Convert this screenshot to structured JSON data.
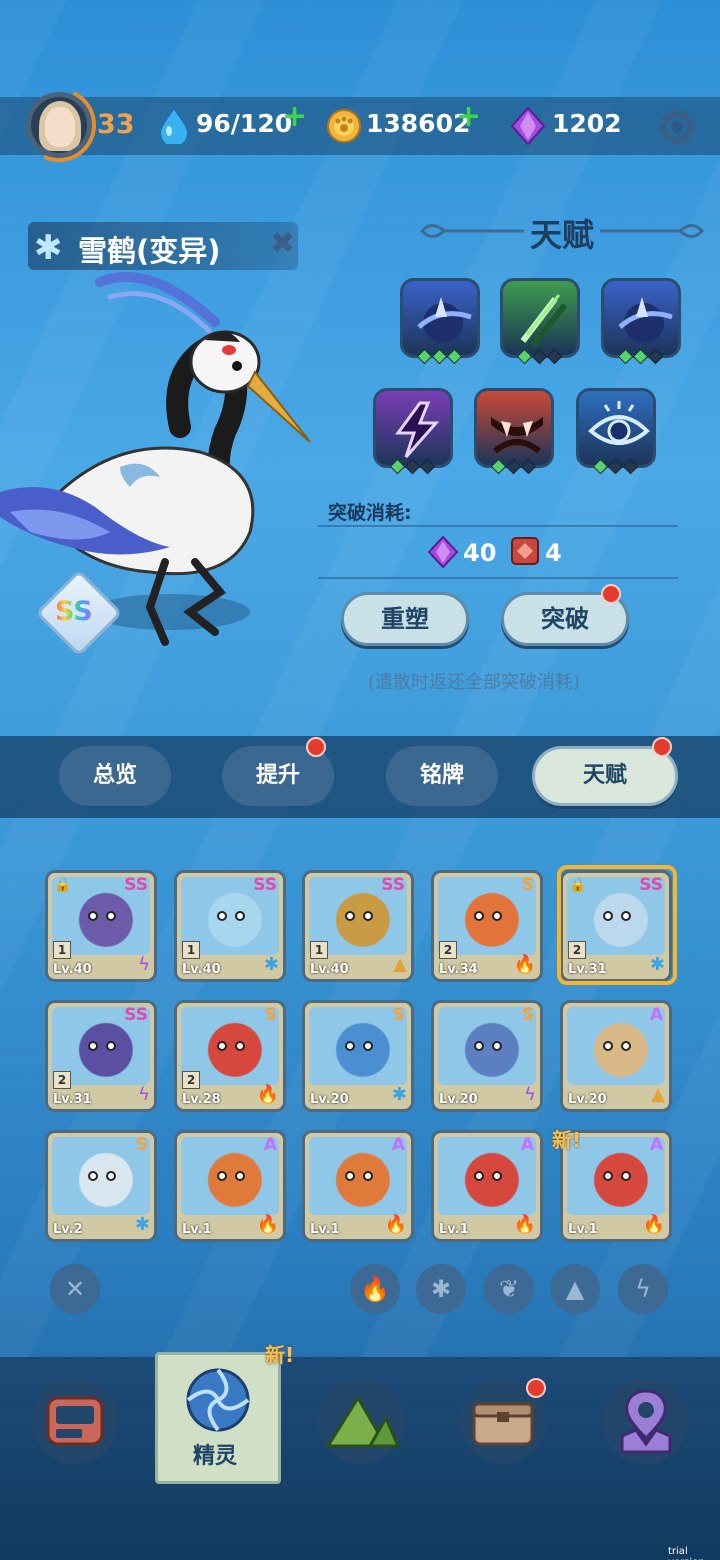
{
  "player": {
    "level": "33",
    "stamina": "96/120",
    "coins": "138602",
    "gems": "1202"
  },
  "pet": {
    "name": "雪鹤(变异)",
    "rank": "SS"
  },
  "talent": {
    "title": "天赋",
    "cost_label": "突破消耗:",
    "cost_gem": "40",
    "cost_item": "4",
    "reset_button": "重塑",
    "breakthrough_button": "突破",
    "hint": "(遣散时返还全部突破消耗)",
    "skills": [
      {
        "icon": "dark-dash-icon",
        "color": "#3b62c9",
        "filled": 3
      },
      {
        "icon": "claw-slash-icon",
        "color": "#3f9b4e",
        "filled": 1
      },
      {
        "icon": "dark-dash-icon",
        "color": "#3b62c9",
        "filled": 2
      },
      {
        "icon": "lightning-icon",
        "color": "#7a3fb6",
        "filled": 1
      },
      {
        "icon": "fang-icon",
        "color": "#c94a37",
        "filled": 1
      },
      {
        "icon": "eye-icon",
        "color": "#2f6fc0",
        "filled": 1
      }
    ]
  },
  "tabs": [
    "总览",
    "提升",
    "铭牌",
    "天赋"
  ],
  "active_tab": "天赋",
  "pets": [
    {
      "rank": "SS",
      "lv": "Lv.40",
      "star": "1",
      "elem": "lightning",
      "locked": true,
      "art": "#6b5ba8"
    },
    {
      "rank": "SS",
      "lv": "Lv.40",
      "star": "1",
      "elem": "ice",
      "locked": false,
      "art": "#a7d7ef"
    },
    {
      "rank": "SS",
      "lv": "Lv.40",
      "star": "1",
      "elem": "earth",
      "locked": false,
      "art": "#c99a44"
    },
    {
      "rank": "S",
      "lv": "Lv.34",
      "star": "2",
      "elem": "fire",
      "locked": false,
      "art": "#e2733a"
    },
    {
      "rank": "SS",
      "lv": "Lv.31",
      "star": "2",
      "elem": "ice",
      "locked": true,
      "art": "#bcd8ec"
    },
    {
      "rank": "SS",
      "lv": "Lv.31",
      "star": "2",
      "elem": "lightning",
      "locked": false,
      "art": "#5a4fa0"
    },
    {
      "rank": "S",
      "lv": "Lv.28",
      "star": "2",
      "elem": "fire",
      "locked": false,
      "art": "#d6483d"
    },
    {
      "rank": "S",
      "lv": "Lv.20",
      "star": "",
      "elem": "ice",
      "locked": false,
      "art": "#4b8fd0"
    },
    {
      "rank": "S",
      "lv": "Lv.20",
      "star": "",
      "elem": "lightning",
      "locked": false,
      "art": "#5b7fc0"
    },
    {
      "rank": "A",
      "lv": "Lv.20",
      "star": "",
      "elem": "earth",
      "locked": false,
      "art": "#d9b887"
    },
    {
      "rank": "S",
      "lv": "Lv.2",
      "star": "",
      "elem": "ice",
      "locked": false,
      "art": "#d8e6f0"
    },
    {
      "rank": "A",
      "lv": "Lv.1",
      "star": "",
      "elem": "fire",
      "locked": false,
      "art": "#e07a3a"
    },
    {
      "rank": "A",
      "lv": "Lv.1",
      "star": "",
      "elem": "fire",
      "locked": false,
      "art": "#e07a3a"
    },
    {
      "rank": "A",
      "lv": "Lv.1",
      "star": "",
      "elem": "fire",
      "locked": false,
      "art": "#d6483d"
    },
    {
      "rank": "A",
      "lv": "Lv.1",
      "star": "",
      "elem": "fire",
      "locked": false,
      "art": "#d6483d"
    }
  ],
  "new_label": "新!",
  "nav": {
    "active_label": "精灵"
  },
  "watermark": "trial version"
}
